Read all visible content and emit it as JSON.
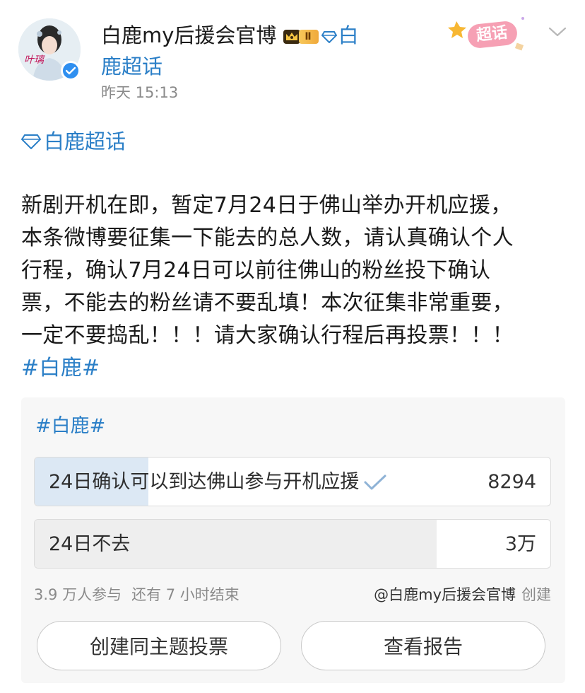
{
  "header": {
    "account_name": "白鹿my后援会官博",
    "badge_level": "Ⅱ",
    "super_topic_link_part1": "白",
    "super_topic_link_part2": "鹿超话",
    "timestamp": "昨天 15:13",
    "sticker_label": "超话",
    "avatar_text": "叶璃"
  },
  "topic_tag": "白鹿超话",
  "post": {
    "lines": [
      "新剧开机在即，暂定7月24日于佛山举办开机应援，",
      "本条微博要征集一下能去的总人数，请认真确认个人",
      "行程，确认7月24日可以前往佛山的粉丝投下确认",
      "票，不能去的粉丝请不要乱填！本次征集非常重要，",
      "一定不要捣乱！！！请大家确认行程后再投票！！！"
    ],
    "hashtag": "#白鹿#"
  },
  "poll": {
    "title": "#白鹿#",
    "options": [
      {
        "label": "24日确认可以到达佛山参与开机应援",
        "count": "8294",
        "share": 0.22,
        "selected": true
      },
      {
        "label": "24日不去",
        "count": "3万",
        "share": 0.78,
        "selected": false
      }
    ],
    "participants": "3.9 万人参与",
    "time_left": "还有 7 小时结束",
    "creator": "@白鹿my后援会官博",
    "creator_suffix": "创建",
    "create_same_label": "创建同主题投票",
    "view_report_label": "查看报告"
  },
  "colors": {
    "link_blue": "#2b7fc7",
    "selected_fill": "#dce8f4",
    "unselected_fill": "#eeeeee",
    "verified_blue": "#2f8ff0"
  }
}
